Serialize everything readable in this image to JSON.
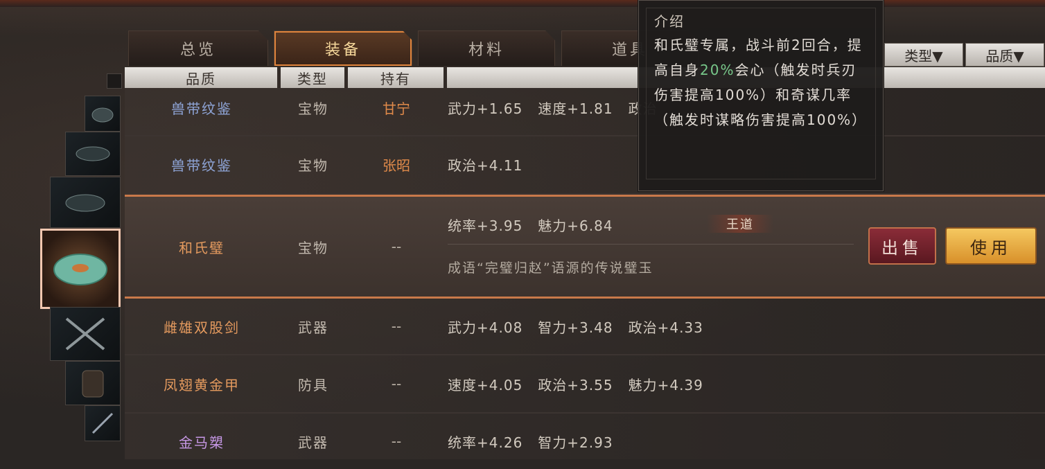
{
  "tabs": [
    {
      "label": "总览"
    },
    {
      "label": "装备"
    },
    {
      "label": "材料"
    },
    {
      "label": "道具"
    }
  ],
  "filters": {
    "type_label": "类型▼",
    "quality_label": "品质▼"
  },
  "columns": {
    "quality": "品质",
    "type": "类型",
    "owner": "持有"
  },
  "items": [
    {
      "name": "兽带纹鉴",
      "type": "宝物",
      "owner": "甘宁",
      "stats": [
        "武力+1.65",
        "速度+1.81",
        "政治"
      ]
    },
    {
      "name": "兽带纹鉴",
      "type": "宝物",
      "owner": "张昭",
      "stats": [
        "政治+4.11"
      ]
    },
    {
      "name": "和氏璧",
      "type": "宝物",
      "owner": "--",
      "stats": [
        "统率+3.95",
        "魅力+6.84"
      ],
      "tag": "王道",
      "description": "成语“完璧归赵”语源的传说璧玉"
    },
    {
      "name": "雌雄双股剑",
      "type": "武器",
      "owner": "--",
      "stats": [
        "武力+4.08",
        "智力+3.48",
        "政治+4.33"
      ]
    },
    {
      "name": "凤翅黄金甲",
      "type": "防具",
      "owner": "--",
      "stats": [
        "速度+4.05",
        "政治+3.55",
        "魅力+4.39"
      ]
    },
    {
      "name": "金马槊",
      "type": "武器",
      "owner": "--",
      "stats": [
        "统率+4.26",
        "智力+2.93"
      ]
    }
  ],
  "actions": {
    "sell": "出售",
    "use": "使用"
  },
  "tooltip": {
    "title": "介绍",
    "text_before": "和氏璧专属，战斗前2回合，提高自身",
    "highlight": "20%",
    "text_after": "会心（触发时兵刃伤害提高100%）和奇谋几率（触发时谋略伤害提高100%）"
  },
  "colors": {
    "active_tab_border": "#e0843c",
    "sell_button": "#8a2c38",
    "use_button": "#f5c860",
    "highlight_green": "#78c88a"
  }
}
